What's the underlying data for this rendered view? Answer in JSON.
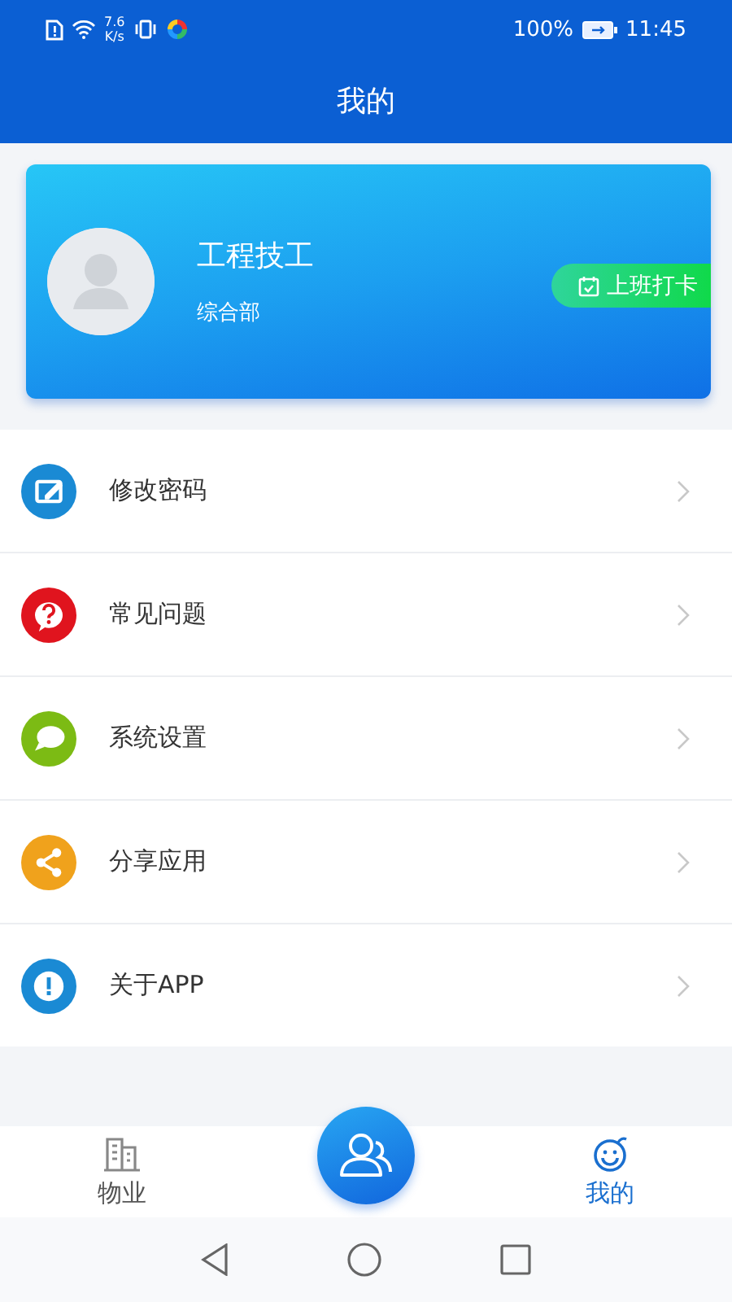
{
  "status_bar": {
    "speed_value": "7.6",
    "speed_unit": "K/s",
    "battery": "100%",
    "time": "11:45"
  },
  "header": {
    "title": "我的"
  },
  "profile": {
    "name": "工程技工",
    "department": "综合部",
    "clock_in_button": "上班打卡"
  },
  "menu": [
    {
      "label": "修改密码",
      "kind": "edit",
      "color": "#1a8ad4"
    },
    {
      "label": "常见问题",
      "kind": "question",
      "color": "#e0141e"
    },
    {
      "label": "系统设置",
      "kind": "chat",
      "color": "#7cbb14"
    },
    {
      "label": "分享应用",
      "kind": "share",
      "color": "#f0a21c"
    },
    {
      "label": "关于APP",
      "kind": "info",
      "color": "#1a8ad4"
    }
  ],
  "tabs": [
    {
      "label": "物业",
      "kind": "building",
      "selected": false
    },
    {
      "kind": "center"
    },
    {
      "label": "我的",
      "kind": "smile",
      "selected": true
    }
  ]
}
